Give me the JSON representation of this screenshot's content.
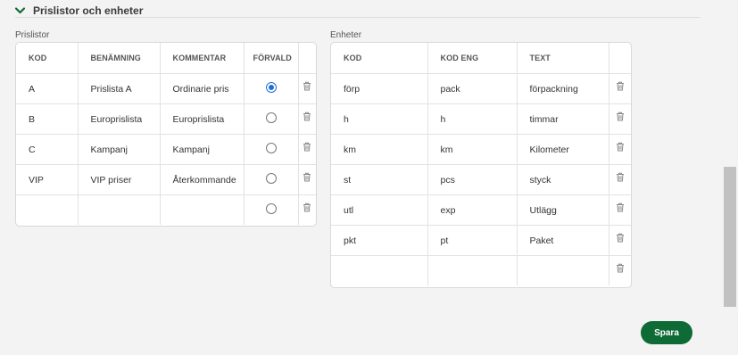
{
  "section": {
    "title": "Prislistor och enheter"
  },
  "prislistor": {
    "label": "Prislistor",
    "headers": [
      "KOD",
      "BENÄMNING",
      "KOMMENTAR",
      "FÖRVALD"
    ],
    "rows": [
      {
        "kod": "A",
        "benamning": "Prislista A",
        "kommentar": "Ordinarie pris",
        "forvald": true
      },
      {
        "kod": "B",
        "benamning": "Europrislista",
        "kommentar": "Europrislista",
        "forvald": false
      },
      {
        "kod": "C",
        "benamning": "Kampanj",
        "kommentar": "Kampanj",
        "forvald": false
      },
      {
        "kod": "VIP",
        "benamning": "VIP priser",
        "kommentar": "Återkommande",
        "forvald": false
      },
      {
        "kod": "",
        "benamning": "",
        "kommentar": "",
        "forvald": false
      }
    ]
  },
  "enheter": {
    "label": "Enheter",
    "headers": [
      "KOD",
      "KOD ENG",
      "TEXT"
    ],
    "rows": [
      {
        "kod": "förp",
        "kod_eng": "pack",
        "text": "förpackning"
      },
      {
        "kod": "h",
        "kod_eng": "h",
        "text": "timmar"
      },
      {
        "kod": "km",
        "kod_eng": "km",
        "text": "Kilometer"
      },
      {
        "kod": "st",
        "kod_eng": "pcs",
        "text": "styck"
      },
      {
        "kod": "utl",
        "kod_eng": "exp",
        "text": "Utlägg"
      },
      {
        "kod": "pkt",
        "kod_eng": "pt",
        "text": "Paket"
      },
      {
        "kod": "",
        "kod_eng": "",
        "text": ""
      }
    ]
  },
  "actions": {
    "save_label": "Spara"
  },
  "colors": {
    "accent": "#0e6b36",
    "radio_selected": "#1f6fd6"
  }
}
